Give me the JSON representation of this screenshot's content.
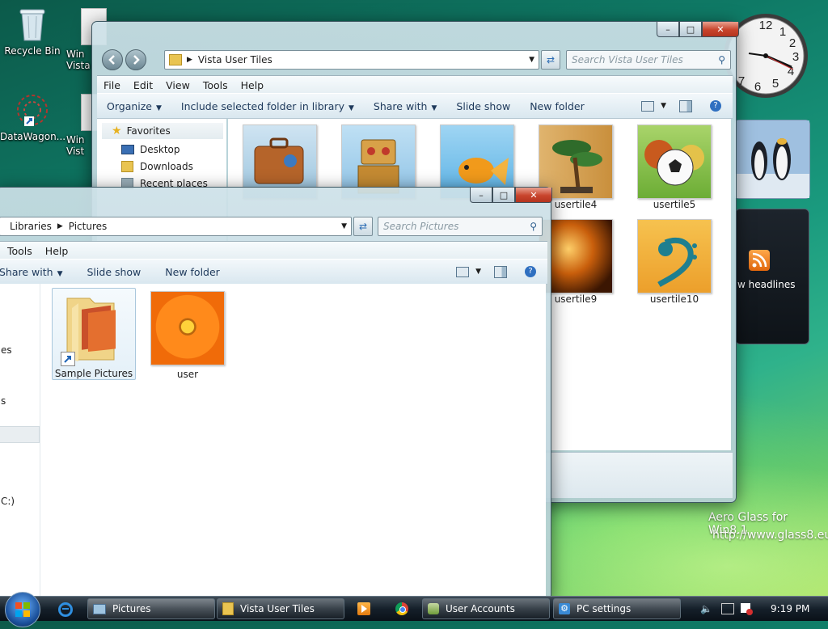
{
  "desktop": {
    "icons": [
      {
        "label": "Recycle Bin"
      },
      {
        "label": "Win Vista"
      },
      {
        "label": "DataWagon..."
      },
      {
        "label": "Win Vist"
      }
    ],
    "watermark_line1": "Aero Glass for Win8.1",
    "watermark_line2": "http://www.glass8.eu"
  },
  "gadgets": {
    "clock_numbers": [
      "12",
      "1",
      "2",
      "3",
      "4",
      "5",
      "6",
      "7"
    ],
    "feed_text": "w headlines"
  },
  "window_back": {
    "address": "Vista User Tiles",
    "search_placeholder": "Search Vista User Tiles",
    "menu": [
      "File",
      "Edit",
      "View",
      "Tools",
      "Help"
    ],
    "toolbar": {
      "organize": "Organize",
      "include": "Include selected folder in library",
      "share": "Share with",
      "slideshow": "Slide show",
      "newfolder": "New folder"
    },
    "nav": {
      "favorites": "Favorites",
      "desktop": "Desktop",
      "downloads": "Downloads",
      "recent": "Recent places"
    },
    "tiles": [
      {
        "label": ""
      },
      {
        "label": ""
      },
      {
        "label": ""
      },
      {
        "label": "usertile4"
      },
      {
        "label": "usertile5"
      },
      {
        "label": "usertile9"
      },
      {
        "label": "usertile10"
      }
    ]
  },
  "window_front": {
    "crumbs": [
      "Libraries",
      "Pictures"
    ],
    "search_placeholder": "Search Pictures",
    "menu": [
      "Tools",
      "Help"
    ],
    "toolbar": {
      "share": "Share with",
      "slideshow": "Slide show",
      "newfolder": "New folder"
    },
    "nav_fragments": [
      "es",
      "s",
      "C:)"
    ],
    "items": [
      {
        "label": "Sample Pictures"
      },
      {
        "label": "user"
      }
    ]
  },
  "taskbar": {
    "buttons": [
      {
        "label": "Pictures"
      },
      {
        "label": "Vista User Tiles"
      },
      {
        "label": "User Accounts"
      },
      {
        "label": "PC settings"
      }
    ],
    "time": "9:19 PM"
  }
}
